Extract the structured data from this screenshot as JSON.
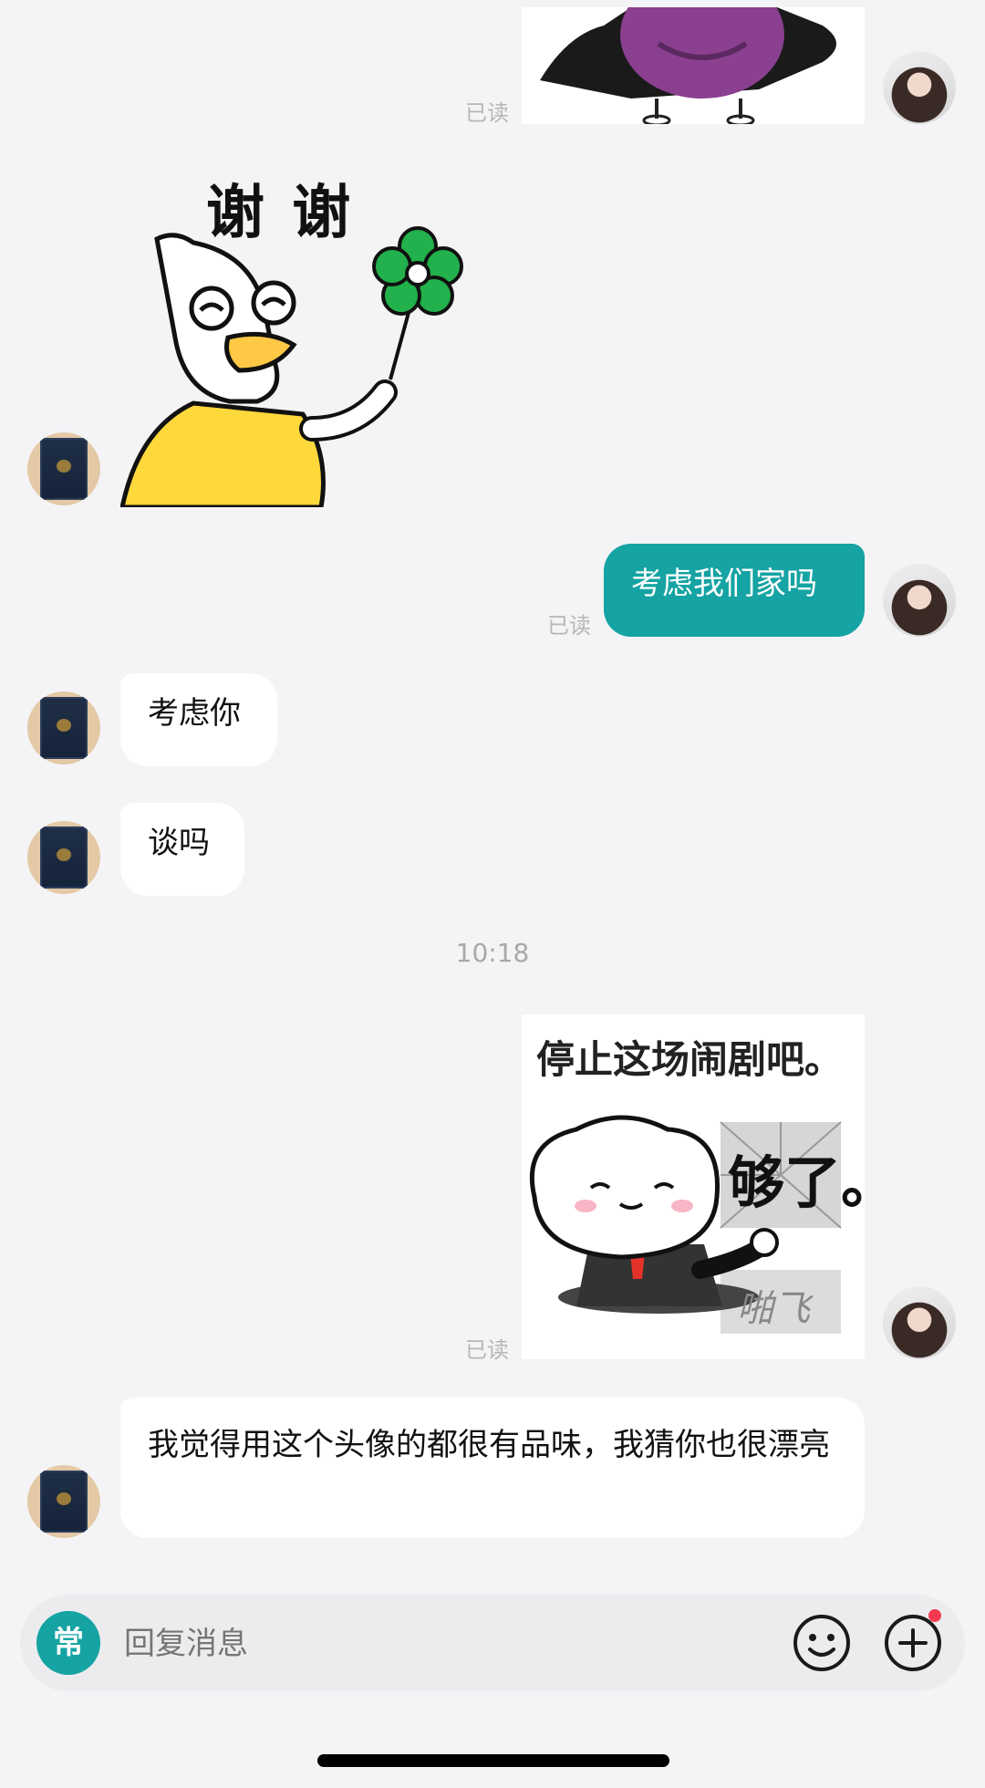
{
  "messages": {
    "read_label": "已读",
    "sticker_thanks_text": "谢 谢",
    "outgoing_1": "考虑我们家吗",
    "incoming_1": "考虑你",
    "incoming_2": "谈吗",
    "timestamp": "10:18",
    "sticker_stop_title": "停止这场闹剧吧。",
    "sticker_stop_enough": "够了。",
    "sticker_stop_bottom": "啪飞",
    "incoming_3": "我觉得用这个头像的都很有品味，我猜你也很漂亮"
  },
  "input_bar": {
    "quick_reply_label": "常",
    "placeholder": "回复消息"
  },
  "colors": {
    "accent": "#15A3A3",
    "background": "#F4F4F6",
    "notification_dot": "#F2394E"
  },
  "icons": [
    "emoji-icon",
    "plus-icon",
    "notification-dot-icon"
  ]
}
